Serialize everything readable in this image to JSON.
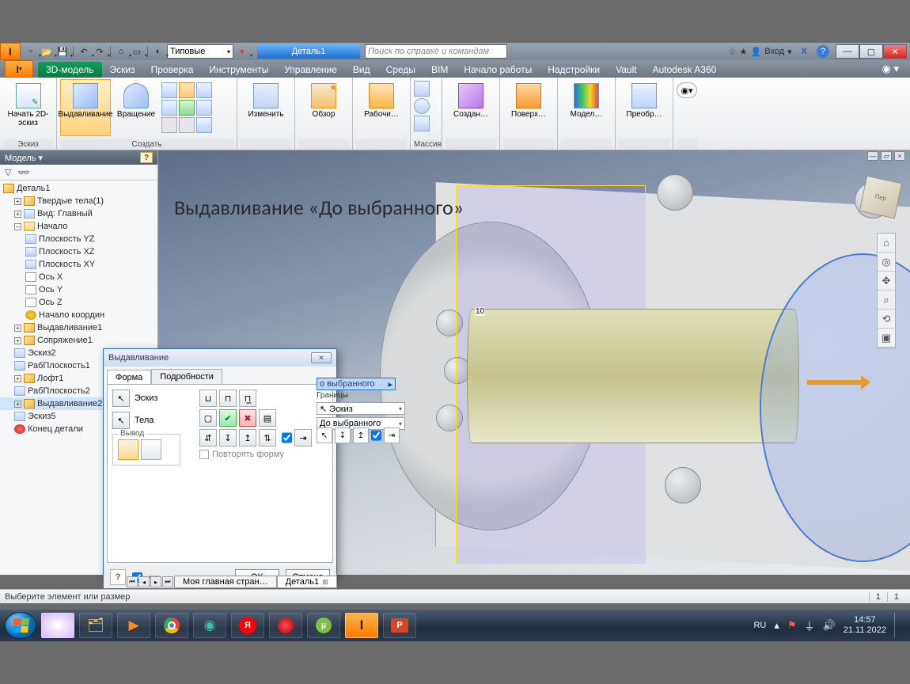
{
  "qat": {
    "workspace": "Типовые",
    "doc_title": "Деталь1",
    "search_placeholder": "Поиск по справке и командам",
    "signin": "Вход"
  },
  "tabs": {
    "t0": "3D-модель",
    "t1": "Эскиз",
    "t2": "Проверка",
    "t3": "Инструменты",
    "t4": "Управление",
    "t5": "Вид",
    "t6": "Среды",
    "t7": "BIM",
    "t8": "Начало работы",
    "t9": "Надстройки",
    "t10": "Vault",
    "t11": "Autodesk A360"
  },
  "ribbon": {
    "sketch": {
      "label": "Эскиз",
      "btn": "Начать 2D-эскиз"
    },
    "create": {
      "label": "Создать",
      "extrude": "Выдавливание",
      "revolve": "Вращение"
    },
    "modify": {
      "btn": "Изменить"
    },
    "explore": {
      "btn": "Обзор"
    },
    "work": {
      "btn": "Рабочи…"
    },
    "pattern": {
      "label": "Массив"
    },
    "createff": {
      "btn": "Создан…"
    },
    "surface": {
      "btn": "Поверх…"
    },
    "model": {
      "btn": "Модел…"
    },
    "convert": {
      "btn": "Преобр…"
    }
  },
  "browser": {
    "title": "Модель ▾",
    "root": "Деталь1",
    "i0": "Твердые тела(1)",
    "i1": "Вид: Главный",
    "i2": "Начало",
    "p0": "Плоскость YZ",
    "p1": "Плоскость XZ",
    "p2": "Плоскость XY",
    "a0": "Ось X",
    "a1": "Ось Y",
    "a2": "Ось Z",
    "org": "Начало координ",
    "f0": "Выдавливание1",
    "f1": "Сопряжение1",
    "f2": "Эскиз2",
    "f3": "РабПлоскость1",
    "f4": "Лофт1",
    "f5": "РабПлоскость2",
    "f6": "Выдавливание2",
    "f7": "Эскиз5",
    "eop": "Конец детали"
  },
  "overlay": "Выдавливание «До выбранного»",
  "dim": "10",
  "dialog": {
    "title": "Выдавливание",
    "tab_shape": "Форма",
    "tab_more": "Подробности",
    "profile": "Эскиз",
    "solids": "Тела",
    "output": "Вывод",
    "extents_val": "о выбранного",
    "extents_lbl": "Границы",
    "extents_combo1": "Эскиз",
    "extents_combo2": "До выбранного",
    "repeat": "Повторять форму",
    "ok": "OK",
    "cancel": "Отмена"
  },
  "doctabs": {
    "t0": "Моя главная стран…",
    "t1": "Деталь1"
  },
  "status": {
    "prompt": "Выберите элемент или размер",
    "c1": "1",
    "c2": "1"
  },
  "tray": {
    "lang": "RU",
    "time": "14:57",
    "date": "21.11.2022"
  }
}
